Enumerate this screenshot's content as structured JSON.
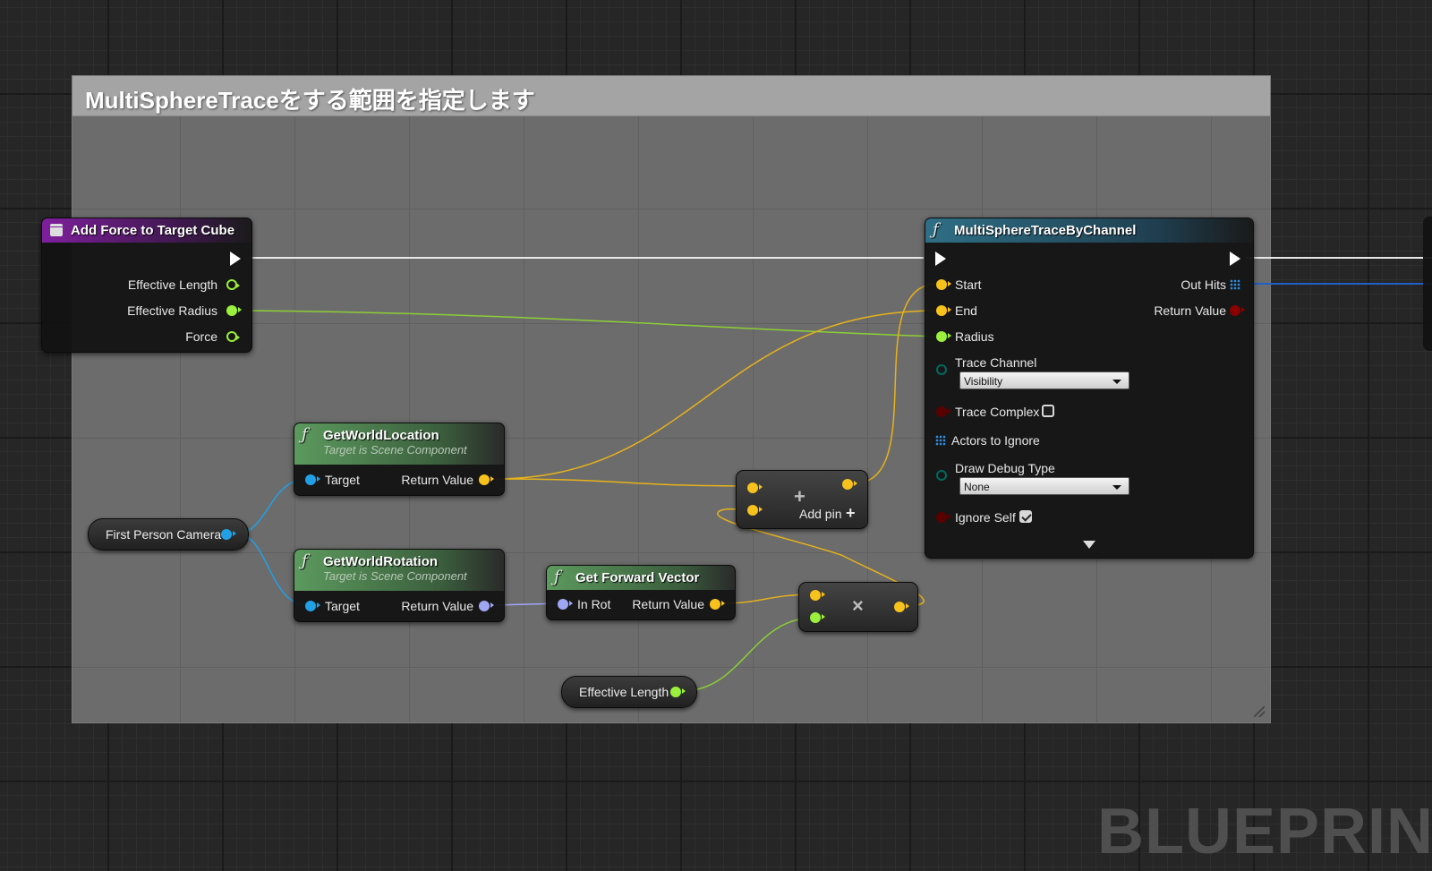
{
  "comment": {
    "title": "MultiSphereTraceをする範囲を指定します"
  },
  "event_node": {
    "title": "Add Force to Target Cube",
    "outputs": [
      "Effective Length",
      "Effective Radius",
      "Force"
    ]
  },
  "trace_node": {
    "title": "MultiSphereTraceByChannel",
    "inputs": {
      "start": "Start",
      "end": "End",
      "radius": "Radius",
      "trace_channel": "Trace Channel",
      "trace_channel_value": "Visibility",
      "trace_complex": "Trace Complex",
      "actors_to_ignore": "Actors to Ignore",
      "draw_debug_type": "Draw Debug Type",
      "draw_debug_value": "None",
      "ignore_self": "Ignore Self"
    },
    "outputs": {
      "out_hits": "Out Hits",
      "return_value": "Return Value"
    }
  },
  "get_world_location": {
    "title": "GetWorldLocation",
    "subtitle": "Target is Scene Component",
    "target": "Target",
    "return_value": "Return Value"
  },
  "get_world_rotation": {
    "title": "GetWorldRotation",
    "subtitle": "Target is Scene Component",
    "target": "Target",
    "return_value": "Return Value"
  },
  "get_forward_vector": {
    "title": "Get Forward Vector",
    "in_rot": "In Rot",
    "return_value": "Return Value"
  },
  "camera_var": {
    "label": "First Person Camera"
  },
  "length_var": {
    "label": "Effective Length"
  },
  "add_node": {
    "add_pin": "Add pin"
  },
  "watermark": "BLUEPRINT",
  "colors": {
    "exec": "#ffffff",
    "float": "#9af03c",
    "vector": "#f7c21b",
    "object": "#22a0e6",
    "rotator": "#9fa7f5",
    "enum": "#00695e",
    "bool": "#8c0000",
    "array": "#2d8ee0"
  },
  "icons": [
    "function-icon",
    "event-icon",
    "array-grid-icon",
    "exec-pin-icon",
    "checkbox-icon",
    "dropdown-caret-icon",
    "expand-arrow-icon"
  ]
}
